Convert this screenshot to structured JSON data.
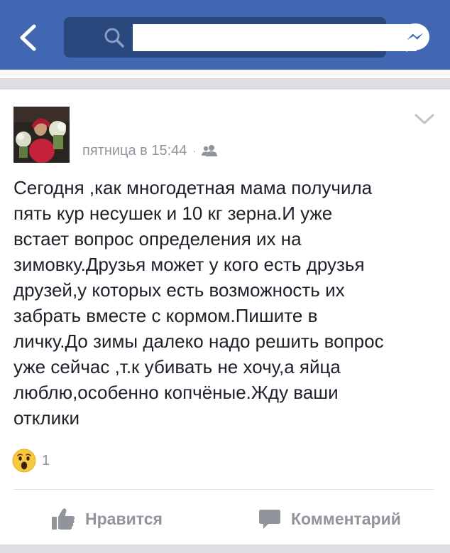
{
  "header": {
    "search": {
      "value": "",
      "placeholder": ""
    },
    "icons": {
      "back": "back-arrow-icon",
      "search": "search-icon",
      "messenger": "messenger-icon"
    }
  },
  "post": {
    "meta": {
      "time": "пятница в 15:44",
      "separator": "·",
      "privacy_icon": "friends-icon"
    },
    "text": "Сегодня ,как многодетная мама получила\nпять кур несушек и 10 кг зерна.И уже\nвстает вопрос определения их на\nзимовку.Друзья может у кого есть друзья\nдрузей,у которых есть возможность их\nзабрать вместе с кормом.Пишите в\nличку.До зимы далеко надо решить вопрос\nуже сейчас ,т.к убивать не хочу,а яйца\nлюблю,особенно копчёные.Жду ваши\nотклики",
    "reactions": {
      "icon": "wow-reaction-icon",
      "count": "1"
    },
    "actions": {
      "like_label": "Нравится",
      "comment_label": "Комментарий"
    }
  },
  "colors": {
    "header_bg": "#4267b2",
    "search_bg": "#29487d",
    "meta_text": "#90949c",
    "body_text": "#1d2129",
    "separator": "#dddfe2"
  }
}
